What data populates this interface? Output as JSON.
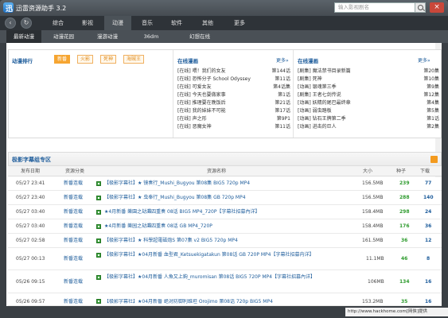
{
  "app": {
    "title": "迅雷资源助手 3.2",
    "logo_letter": "迅"
  },
  "search": {
    "placeholder": "输入影视剧名"
  },
  "nav": {
    "back": "‹",
    "refresh": "↻",
    "items": [
      "综合",
      "影视",
      "动漫",
      "音乐",
      "软件",
      "其他",
      "更多"
    ],
    "active_index": 2
  },
  "subnav": {
    "items": [
      "最新动漫",
      "动漫花园",
      "漫游动漫",
      "36dm",
      "幻想在线"
    ],
    "active_index": 0
  },
  "anime_rank": {
    "title": "动漫排行",
    "tags": [
      "新番",
      "火影",
      "死神",
      "海贼王"
    ],
    "active_tag": 0
  },
  "update_mid": {
    "title": "在线漫画",
    "more": "更多»",
    "items": [
      {
        "title": "[在线] 喂！我们的女友",
        "ep": "第144话"
      },
      {
        "title": "[在线] 恐怖分子 School Odyssey",
        "ep": "第11话"
      },
      {
        "title": "[在线] 可爱女友",
        "ep": "第4话集"
      },
      {
        "title": "[在线] 今天也要做家事",
        "ep": "第1话"
      },
      {
        "title": "[在线] 推理要在晚饭后",
        "ep": "第21话"
      },
      {
        "title": "[在线] 我的妹妹不可能",
        "ep": "第17话"
      },
      {
        "title": "[在线] 声之形",
        "ep": "第9P1"
      },
      {
        "title": "[在线] 恶魔女神",
        "ep": "第11话"
      }
    ]
  },
  "update_right": {
    "title": "在线漫画",
    "more": "更多»",
    "items": [
      {
        "title": "[剧集] 魔法禁书目录新篇",
        "ep": "第20集"
      },
      {
        "title": "[剧集] 死神",
        "ep": "第10集"
      },
      {
        "title": "[动画] 银魂第三季",
        "ep": "第9集"
      },
      {
        "title": "[剧集] 王者七剑传说",
        "ep": "第12集"
      },
      {
        "title": "[动画] 妖精的尾巴最终章",
        "ep": "第4集"
      },
      {
        "title": "[动画] 弱虫踏板",
        "ep": "第5集"
      },
      {
        "title": "[动画] 钻石王牌第二季",
        "ep": "第1话"
      },
      {
        "title": "[动画] 进击的巨人",
        "ep": "第2集"
      }
    ]
  },
  "section": {
    "title": "极影字幕组专区"
  },
  "table": {
    "headers": [
      "发布日期",
      "资源分类",
      "资源名称",
      "大小",
      "种子",
      "下载"
    ],
    "rows": [
      {
        "date": "05/27 23:41",
        "cat": "新番连载",
        "title": "【极影字幕社】★ 镜奏行_Mushi_Bugyou 第08集 BIG5 720p MP4",
        "size": "156.5MB",
        "seeds": "239",
        "dl": "77"
      },
      {
        "date": "05/27 23:40",
        "cat": "新番连载",
        "title": "【极影字幕社】★ 虫奉行_Mushi_Bugyou 第08集 GB 720p MP4",
        "size": "156.5MB",
        "seeds": "288",
        "dl": "140"
      },
      {
        "date": "05/27 03:40",
        "cat": "新番连载",
        "title": "★4月新番 樂園之劫灘四重奏 08话 BIG5 MP4_720P【字幕社招募內详】",
        "size": "158.4MB",
        "seeds": "298",
        "dl": "24"
      },
      {
        "date": "05/27 03:40",
        "cat": "新番连载",
        "title": "★4月新番 樂园之劫灘四重奏 08话 GB MP4_720P",
        "size": "158.4MB",
        "seeds": "176",
        "dl": "36"
      },
      {
        "date": "05/27 02:58",
        "cat": "新番连载",
        "title": "【极影字幕社】★ 科學超電磁炮S 第07集 v2 BIG5 720p MP4",
        "size": "161.5MB",
        "seeds": "36",
        "dl": "12"
      },
      {
        "date": "05/27 00:13",
        "cat": "新番连载",
        "title": "【极影字幕社】★04月新番 血型君_Ketsuekigatakun 第08话 GB 720P MP4【字幕社招募内详】",
        "size": "11.1MB",
        "seeds": "46",
        "dl": "8"
      },
      {
        "date": "05/26 09:15",
        "cat": "新番连载",
        "title": "【极影字幕社】★04月新番 人魚又上鉤_muromisan 第08话 BIG5 720P MP4【字幕社招募內详】",
        "size": "106MB",
        "seeds": "134",
        "dl": "16"
      },
      {
        "date": "05/26 09:57",
        "cat": "新番连载",
        "title": "【极影字幕社】★04月新番 绝对防御利维坦 Orojimo 第08话 720p BIG5 MP4",
        "size": "153.2MB",
        "seeds": "35",
        "dl": "16"
      }
    ]
  },
  "statusbar": {
    "ad": "http://www.hackhome.com[网侠]提供"
  },
  "colors": {
    "accent": "#1d5c9b",
    "tag": "#f6a531",
    "seed": "#2e9b2e",
    "close": "#c9473a"
  }
}
